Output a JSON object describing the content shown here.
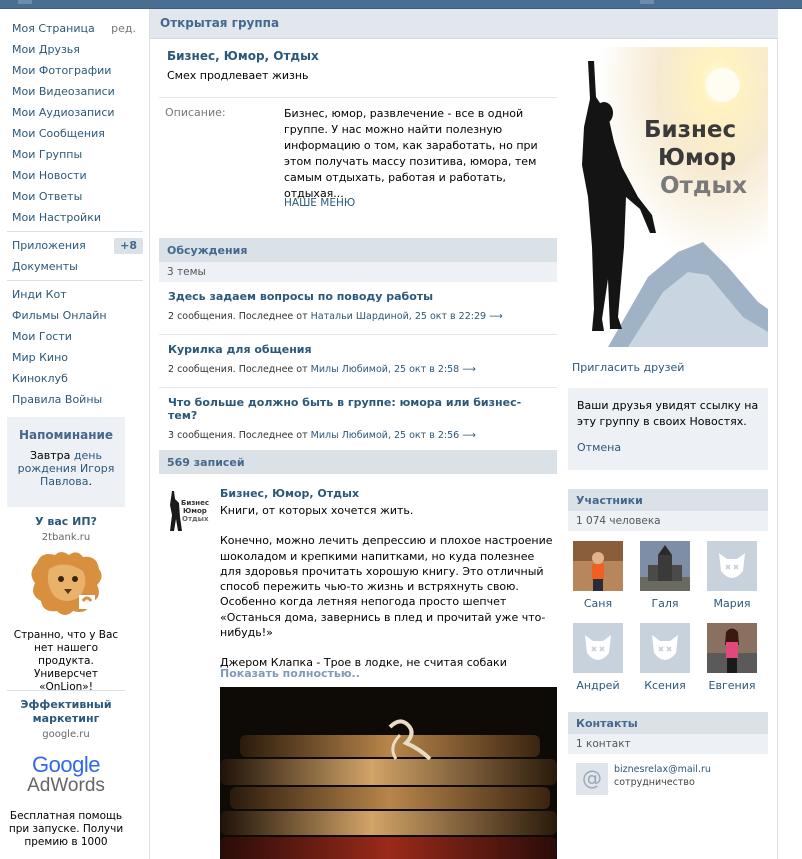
{
  "nav": {
    "items": [
      {
        "label": "Моя Страница",
        "edit": "ред."
      },
      {
        "label": "Мои Друзья"
      },
      {
        "label": "Мои Фотографии"
      },
      {
        "label": "Мои Видеозаписи"
      },
      {
        "label": "Мои Аудиозаписи"
      },
      {
        "label": "Мои Сообщения"
      },
      {
        "label": "Мои Группы"
      },
      {
        "label": "Мои Новости"
      },
      {
        "label": "Мои Ответы"
      },
      {
        "label": "Мои Настройки"
      }
    ],
    "apps": {
      "label": "Приложения",
      "count": "+8"
    },
    "docs": "Документы",
    "extra": [
      "Инди Кот",
      "Фильмы Онлайн",
      "Мои Гости",
      "Мир Кино",
      "Киноклуб",
      "Правила Войны"
    ]
  },
  "reminder": {
    "title": "Напоминание",
    "pre": "Завтра",
    "mid": "день рождения",
    "name": "Игоря Павлова",
    "post": "."
  },
  "ads": [
    {
      "title": "У вас ИП?",
      "domain": "2tbank.ru",
      "text": "Странно, что у Вас нет нашего продукта. Универсчет «OnLion»!"
    },
    {
      "title": "Эффективный маркетинг",
      "domain": "google.ru",
      "logo1": "Google",
      "logo2": "AdWords",
      "text": "Бесплатная помощь при запуске. Получи премию в 1000"
    }
  ],
  "group": {
    "header": "Открытая группа",
    "name": "Бизнес, Юмор, Отдых",
    "status": "Смех продлевает жизнь",
    "desc_label": "Описание:",
    "desc": "Бизнес, юмор, развлечение - все в одной группе. У нас можно найти полезную информацию о том, как заработать, но при этом получать массу позитива, юмора, тем самым отдыхать, работая и работать, отдыхая...",
    "menu": "НАШЕ МЕНЮ",
    "logo": [
      "Бизнес",
      "Юмор",
      "Отдых"
    ]
  },
  "discussions": {
    "title": "Обсуждения",
    "count": "3 темы",
    "topics": [
      {
        "title": "Здесь задаем вопросы по поводу работы",
        "meta": "2 сообщения. Последнее от",
        "author": "Натальи Шардиной, 25 окт в 22:29",
        "arrow": "⟶"
      },
      {
        "title": "Курилка для общения",
        "meta": "2 сообщения. Последнее от",
        "author": "Милы Любимой, 25 окт в 2:58",
        "arrow": "⟶"
      },
      {
        "title": "Что больше должно быть в группе: юмора или бизнес-тем?",
        "meta": "3 сообщения. Последнее от",
        "author": "Милы Любимой, 25 окт в 2:56",
        "arrow": "⟶"
      }
    ]
  },
  "wall": {
    "title": "569 записей",
    "post": {
      "author": "Бизнес, Юмор, Отдых",
      "lines": [
        "Книги, от которых хочется жить.",
        "",
        "Конечно, можно лечить депрессию и плохое настроение шоколадом и крепкими напитками, но куда полезнее для здоровья прочитать хорошую книгу. Это отличный способ пережить чью-то жизнь и встряхнуть свою. Особенно когда летняя непогода просто шепчет «Останься дома, завернись в плед и прочитай уже что-нибудь!»",
        "",
        "Джером Клапка - Трое в лодке, не считая собаки"
      ],
      "more": "Показать полностью.."
    }
  },
  "side": {
    "invite": "Пригласить друзей",
    "info": "Ваши друзья увидят ссылку на эту группу в своих Новостях.",
    "cancel": "Отмена",
    "members_title": "Участники",
    "members_count": "1 074 человека",
    "members": [
      {
        "name": "Саня",
        "kind": "photo-man"
      },
      {
        "name": "Галя",
        "kind": "photo-church"
      },
      {
        "name": "Мария",
        "kind": "deactivated"
      },
      {
        "name": "Андрей",
        "kind": "deactivated"
      },
      {
        "name": "Ксения",
        "kind": "deactivated"
      },
      {
        "name": "Евгения",
        "kind": "photo-woman"
      }
    ],
    "contacts_title": "Контакты",
    "contacts_count": "1 контакт",
    "contact": {
      "email": "biznesrelax@mail.ru",
      "role": "сотрудничество",
      "icon": "@"
    }
  },
  "colors": {
    "accent": "#45688e",
    "link": "#2b587a",
    "header_bg": "#dae2e8",
    "topbar": "#4a6e91"
  }
}
